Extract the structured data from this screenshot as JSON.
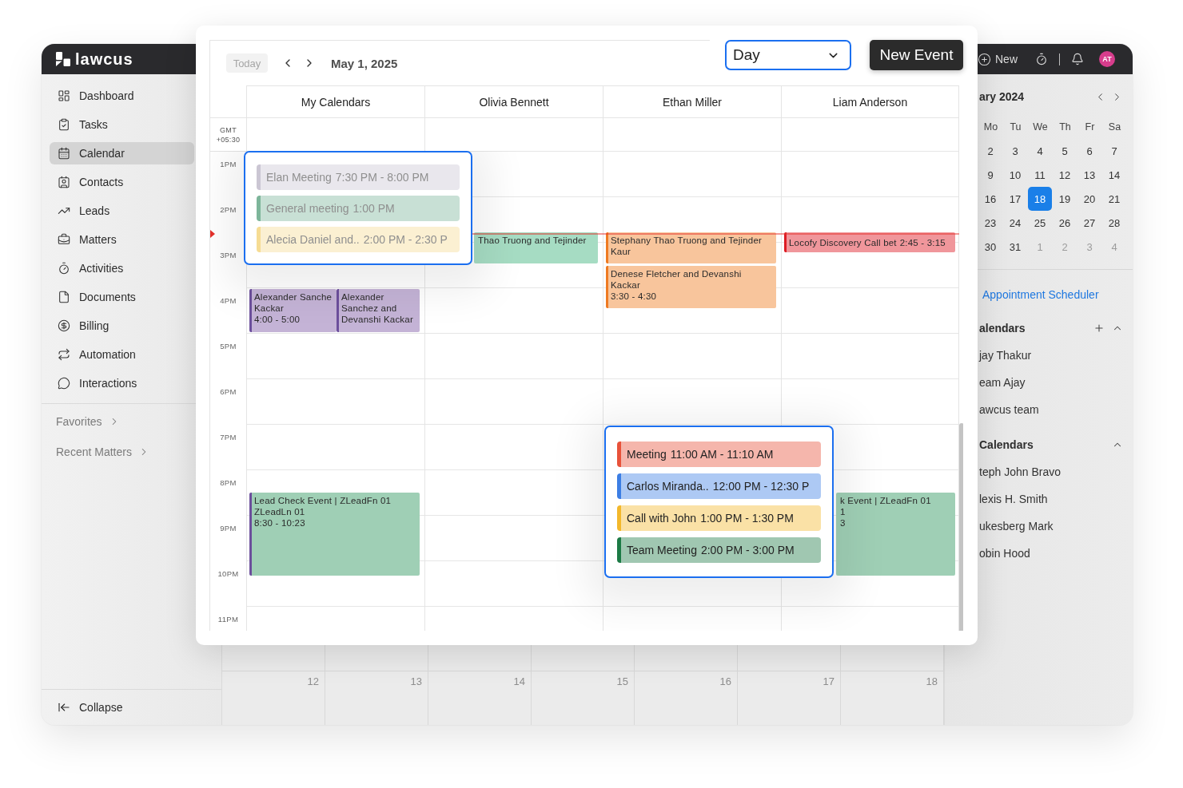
{
  "app": {
    "top_bar": {
      "logo": "lawcus",
      "new_button": "New",
      "avatar": "AT"
    },
    "sidebar": {
      "items": [
        {
          "label": "Dashboard",
          "selected": false
        },
        {
          "label": "Tasks",
          "selected": false
        },
        {
          "label": "Calendar",
          "selected": true
        },
        {
          "label": "Contacts",
          "selected": false
        },
        {
          "label": "Leads",
          "selected": false
        },
        {
          "label": "Matters",
          "selected": false
        },
        {
          "label": "Activities",
          "selected": false
        },
        {
          "label": "Documents",
          "selected": false
        },
        {
          "label": "Billing",
          "selected": false
        },
        {
          "label": "Automation",
          "selected": false
        },
        {
          "label": "Interactions",
          "selected": false
        }
      ],
      "sections": [
        "Favorites",
        "Recent Matters"
      ],
      "collapse": "Collapse"
    },
    "month_grid": {
      "days": [
        "12",
        "13",
        "14",
        "15",
        "16",
        "17",
        "18"
      ]
    },
    "mini_calendar": {
      "title": "ary 2024",
      "weekdays": [
        "Mo",
        "Tu",
        "We",
        "Th",
        "Fr",
        "Sa"
      ],
      "weeks": [
        [
          {
            "day": "2",
            "outside_month": false,
            "selected": false
          },
          {
            "day": "3",
            "outside_month": false,
            "selected": false
          },
          {
            "day": "4",
            "outside_month": false,
            "selected": false
          },
          {
            "day": "5",
            "outside_month": false,
            "selected": false
          },
          {
            "day": "6",
            "outside_month": false,
            "selected": false
          },
          {
            "day": "7",
            "outside_month": false,
            "selected": false
          }
        ],
        [
          {
            "day": "9",
            "outside_month": false,
            "selected": false
          },
          {
            "day": "10",
            "outside_month": false,
            "selected": false
          },
          {
            "day": "11",
            "outside_month": false,
            "selected": false
          },
          {
            "day": "12",
            "outside_month": false,
            "selected": false
          },
          {
            "day": "13",
            "outside_month": false,
            "selected": false
          },
          {
            "day": "14",
            "outside_month": false,
            "selected": false
          }
        ],
        [
          {
            "day": "16",
            "outside_month": false,
            "selected": false
          },
          {
            "day": "17",
            "outside_month": false,
            "selected": false
          },
          {
            "day": "18",
            "outside_month": false,
            "selected": true
          },
          {
            "day": "19",
            "outside_month": false,
            "selected": false
          },
          {
            "day": "20",
            "outside_month": false,
            "selected": false
          },
          {
            "day": "21",
            "outside_month": false,
            "selected": false
          }
        ],
        [
          {
            "day": "23",
            "outside_month": false,
            "selected": false
          },
          {
            "day": "24",
            "outside_month": false,
            "selected": false
          },
          {
            "day": "25",
            "outside_month": false,
            "selected": false
          },
          {
            "day": "26",
            "outside_month": false,
            "selected": false
          },
          {
            "day": "27",
            "outside_month": false,
            "selected": false
          },
          {
            "day": "28",
            "outside_month": false,
            "selected": false
          }
        ],
        [
          {
            "day": "30",
            "outside_month": false,
            "selected": false
          },
          {
            "day": "31",
            "outside_month": false,
            "selected": false
          },
          {
            "day": "1",
            "outside_month": true,
            "selected": false
          },
          {
            "day": "2",
            "outside_month": true,
            "selected": false
          },
          {
            "day": "3",
            "outside_month": true,
            "selected": false
          },
          {
            "day": "4",
            "outside_month": true,
            "selected": false
          }
        ]
      ]
    },
    "appointment_link": "Appointment Scheduler",
    "calendar_groups": [
      {
        "title": "alendars",
        "add_button": true,
        "expanded": true,
        "items": [
          "jay Thakur",
          "eam Ajay",
          "awcus team"
        ]
      },
      {
        "title": "Calendars",
        "add_button": false,
        "expanded": true,
        "items": [
          "teph John Bravo",
          "lexis H. Smith",
          "ukesberg Mark",
          "obin Hood"
        ]
      }
    ]
  },
  "day_view": {
    "toolbar": {
      "today": "Today",
      "today_disabled": true,
      "date": "May 1, 2025",
      "view": "Day",
      "new_event": "New Event"
    },
    "timezone": "GMT +05:30",
    "hours": [
      "1PM",
      "2PM",
      "3PM",
      "4PM",
      "5PM",
      "6PM",
      "7PM",
      "8PM",
      "9PM",
      "10PM",
      "11PM"
    ],
    "columns": [
      {
        "name": "My Calendars",
        "color": "#6c4f9c",
        "events": [
          {
            "kind": "stacked",
            "lines": [
              "Alexander Sanche",
              "Kackar"
            ],
            "time": "4:00 - 5:00",
            "color": "#c4b3d6"
          },
          {
            "kind": "stacked",
            "lines": [
              "Alexander",
              "Sanchez and",
              "Devanshi Kackar"
            ],
            "color": "#c4b3d6"
          },
          {
            "kind": "stacked",
            "lines": [
              "Lead Check Event | ZLeadFn 01",
              "ZLeadLn 01"
            ],
            "time": "8:30 - 10:23",
            "color": "#9fcfb5"
          }
        ]
      },
      {
        "name": "Olivia Bennett",
        "events": [
          {
            "kind": "clipped",
            "lines": [
              "Thao Truong and Tejinder"
            ],
            "color": "#a6dcc3"
          }
        ]
      },
      {
        "name": "Ethan Miller",
        "color": "#ee7a22",
        "events": [
          {
            "kind": "stacked",
            "lines": [
              "Stephany Thao Truong and Tejinder",
              "Kaur"
            ],
            "color": "#f8c59c"
          },
          {
            "kind": "stacked",
            "lines": [
              "Denese Fletcher and Devanshi",
              "Kackar"
            ],
            "time": "3:30 - 4:30",
            "color": "#f8c59c"
          }
        ]
      },
      {
        "name": "Liam Anderson",
        "color": "#dd1c24",
        "events": [
          {
            "kind": "inline",
            "lines": [
              "Locofy Discovery Call bet"
            ],
            "time": "2:45 - 3:15",
            "color": "#f0969b"
          },
          {
            "kind": "clipped",
            "lines": [
              "k Event | ZLeadFn 01",
              "1"
            ],
            "time": "3",
            "color": "#9fcfb5"
          }
        ]
      }
    ],
    "popovers": [
      {
        "dimmed": true,
        "items": [
          {
            "title": "Elan Meeting",
            "time": "7:30 PM - 8:00 PM",
            "color": "#cbc6d3"
          },
          {
            "title": "General meeting",
            "time": "1:00 PM",
            "color": "#7db59a"
          },
          {
            "title": "Alecia Daniel and..",
            "time": "2:00 PM - 2:30 P",
            "color": "#f6dc93"
          }
        ]
      },
      {
        "dimmed": false,
        "items": [
          {
            "title": "Meeting",
            "time": "11:00 AM - 11:10 AM",
            "color": "#e8523a"
          },
          {
            "title": "Carlos Miranda..",
            "time": "12:00 PM - 12:30 P",
            "color": "#3c7ee4"
          },
          {
            "title": "Call with John",
            "time": "1:00 PM - 1:30 PM",
            "color": "#f3b82c"
          },
          {
            "title": "Team Meeting",
            "time": "2:00 PM - 3:00 PM",
            "color": "#1c7a45"
          }
        ]
      }
    ]
  }
}
